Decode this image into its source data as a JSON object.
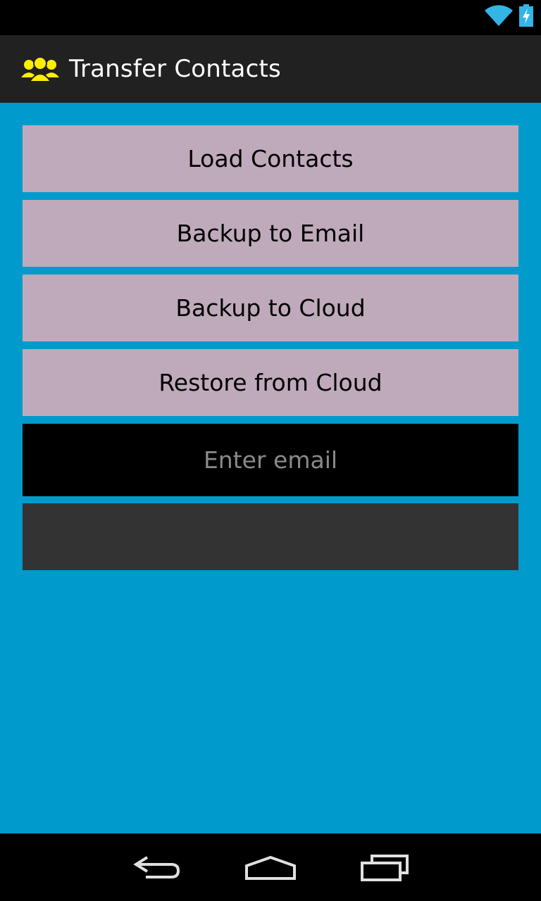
{
  "app": {
    "title": "Transfer Contacts",
    "icon": "contacts-group-icon"
  },
  "status_bar": {
    "icons": [
      "wifi-icon",
      "battery-charging-icon"
    ]
  },
  "buttons": {
    "load_contacts": "Load Contacts",
    "backup_email": "Backup to Email",
    "backup_cloud": "Backup to Cloud",
    "restore_cloud": "Restore from Cloud"
  },
  "email_input": {
    "placeholder": "Enter email",
    "value": ""
  },
  "output": {
    "text": ""
  },
  "nav": {
    "icons": [
      "back-icon",
      "home-icon",
      "recent-apps-icon"
    ]
  },
  "colors": {
    "background": "#009bcc",
    "button": "#bfaabb",
    "action_bar": "#212121",
    "app_icon": "#ffee00",
    "status_icons": "#33b5e5"
  }
}
